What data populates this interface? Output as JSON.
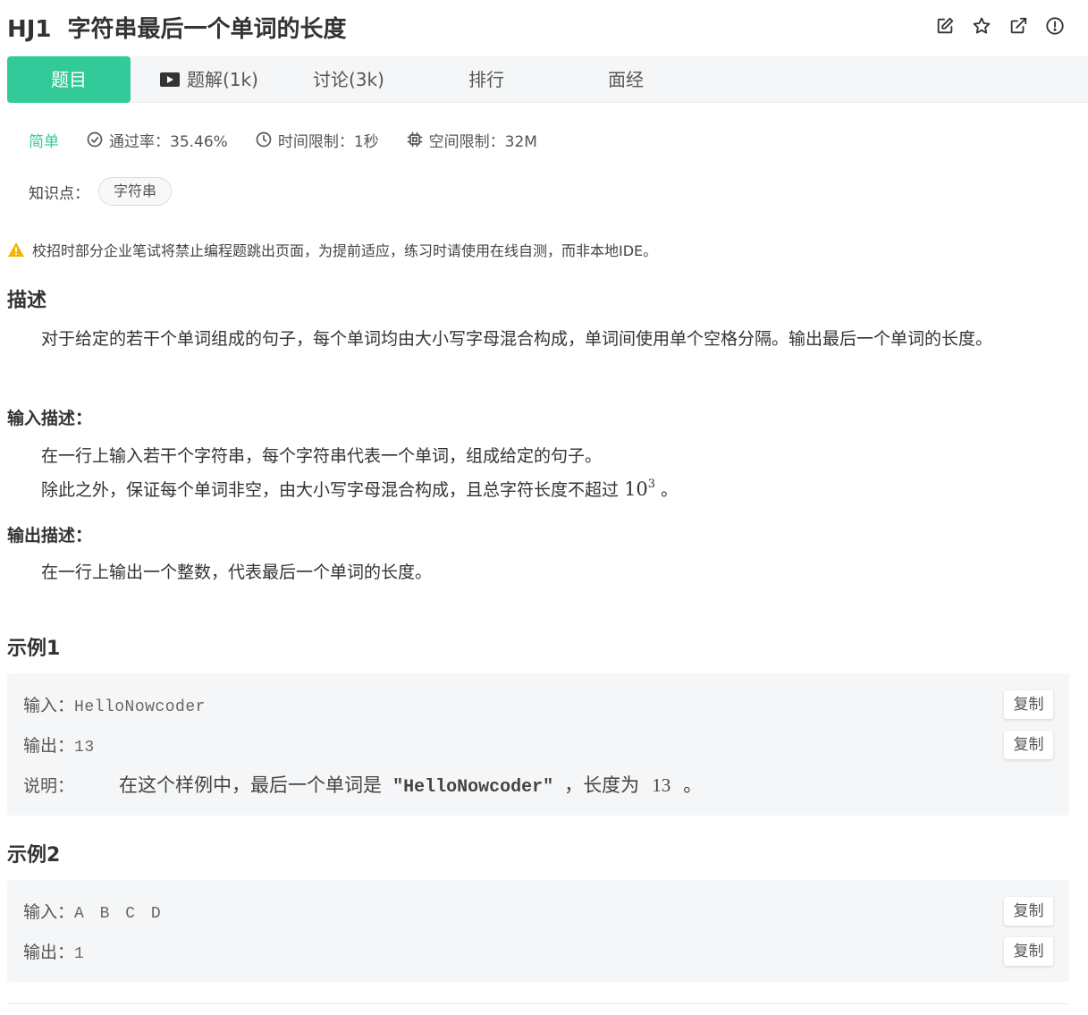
{
  "problem": {
    "code": "HJ1",
    "title": "字符串最后一个单词的长度"
  },
  "toolbar": {
    "icons": [
      "edit-icon",
      "star-icon",
      "share-icon",
      "report-icon"
    ]
  },
  "tabs": [
    {
      "label": "题目",
      "active": true
    },
    {
      "label": "题解(1k)",
      "icon": "video-icon"
    },
    {
      "label": "讨论(3k)"
    },
    {
      "label": "排行"
    },
    {
      "label": "面经"
    }
  ],
  "meta": {
    "difficulty": "简单",
    "pass_rate": "通过率：35.46%",
    "time_limit": "时间限制：1秒",
    "memory_limit": "空间限制：32M"
  },
  "knowledge": {
    "label": "知识点：",
    "tags": [
      "字符串"
    ]
  },
  "warning": "校招时部分企业笔试将禁止编程题跳出页面，为提前适应，练习时请使用在线自测，而非本地IDE。",
  "description": {
    "heading": "描述",
    "text": "对于给定的若干个单词组成的句子，每个单词均由大小写字母混合构成，单词间使用单个空格分隔。输出最后一个单词的长度。"
  },
  "input_desc": {
    "heading": "输入描述：",
    "line1": "在一行上输入若干个字符串，每个字符串代表一个单词，组成给定的句子。",
    "line2_prefix": "除此之外，保证每个单词非空，由大小写字母混合构成，且总字符长度不超过",
    "line2_base": "10",
    "line2_exp": "3",
    "line2_suffix": "。"
  },
  "output_desc": {
    "heading": "输出描述：",
    "line1": "在一行上输出一个整数，代表最后一个单词的长度。"
  },
  "examples": [
    {
      "heading": "示例1",
      "input_label": "输入：",
      "input": "HelloNowcoder",
      "output_label": "输出：",
      "output": "13",
      "explain_label": "说明：",
      "explain_pre": "在这个样例中，最后一个单词是",
      "explain_code": "\"HelloNowcoder\"",
      "explain_mid": "，长度为",
      "explain_num": "13",
      "explain_end": "。",
      "copy_label": "复制"
    },
    {
      "heading": "示例2",
      "input_label": "输入：",
      "input": "A B C D",
      "output_label": "输出：",
      "output": "1",
      "copy_label": "复制"
    }
  ],
  "colors": {
    "accent": "#32ca99",
    "warning": "#f5b400"
  }
}
